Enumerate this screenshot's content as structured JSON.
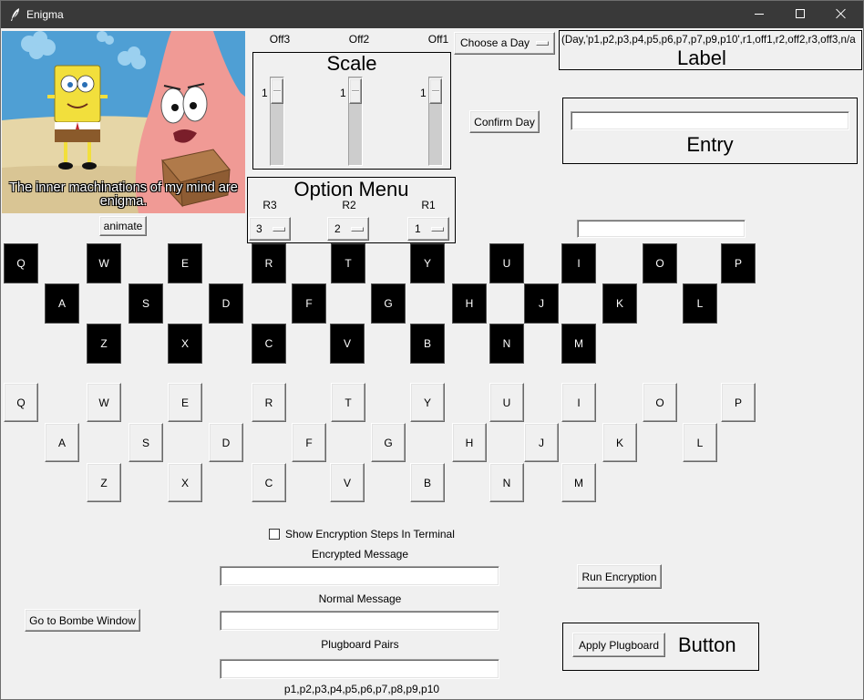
{
  "window": {
    "title": "Enigma",
    "app_icon": "feather-icon",
    "controls": {
      "minimize": "minimize-icon",
      "maximize": "maximize-icon",
      "close": "close-icon"
    }
  },
  "meme": {
    "caption": "The inner machinations of my mind are enigma."
  },
  "offsets": [
    "Off3",
    "Off2",
    "Off1"
  ],
  "scale_frame": {
    "title": "Scale",
    "scales": [
      {
        "value": "1"
      },
      {
        "value": "1"
      },
      {
        "value": "1"
      }
    ]
  },
  "day_menu": {
    "selected": "Choose a Day",
    "indicator_icon": "dropdown-indicator-icon"
  },
  "confirm_day": {
    "label": "Confirm Day"
  },
  "label_frame": {
    "text": "(Day,'p1,p2,p3,p4,p5,p6,p7,p7,p9,p10',r1,off1,r2,off2,r3,off3,n/a",
    "title": "Label"
  },
  "entry_frame": {
    "title": "Entry",
    "value": ""
  },
  "option_frame": {
    "title": "Option Menu",
    "rotors": [
      {
        "label": "R3",
        "selected": "3"
      },
      {
        "label": "R2",
        "selected": "2"
      },
      {
        "label": "R1",
        "selected": "1"
      }
    ]
  },
  "animate": {
    "label": "animate"
  },
  "aux_entry": {
    "value": ""
  },
  "lampboard": {
    "rows": [
      [
        "Q",
        "W",
        "E",
        "R",
        "T",
        "Y",
        "U",
        "I",
        "O",
        "P"
      ],
      [
        "A",
        "S",
        "D",
        "F",
        "G",
        "H",
        "J",
        "K",
        "L"
      ],
      [
        "Z",
        "X",
        "C",
        "V",
        "B",
        "N",
        "M"
      ]
    ]
  },
  "keyboard": {
    "rows": [
      [
        "Q",
        "W",
        "E",
        "R",
        "T",
        "Y",
        "U",
        "I",
        "O",
        "P"
      ],
      [
        "A",
        "S",
        "D",
        "F",
        "G",
        "H",
        "J",
        "K",
        "L"
      ],
      [
        "Z",
        "X",
        "C",
        "V",
        "B",
        "N",
        "M"
      ]
    ]
  },
  "show_steps": {
    "label": "Show Encryption Steps In Terminal",
    "checked": false
  },
  "encrypted_message": {
    "label": "Encrypted Message",
    "value": ""
  },
  "normal_message": {
    "label": "Normal Message",
    "value": ""
  },
  "plugboard_pairs": {
    "label": "Plugboard Pairs",
    "value": "",
    "hint": "p1,p2,p3,p4,p5,p6,p7,p8,p9,p10"
  },
  "run_encryption": {
    "label": "Run Encryption"
  },
  "bombe_window": {
    "label": "Go to Bombe Window"
  },
  "button_frame": {
    "apply_label": "Apply Plugboard",
    "title": "Button"
  },
  "colors": {
    "window_bg": "#f0f0f0",
    "titlebar_bg": "#393939",
    "lamp_bg": "#000000",
    "lamp_text": "#ffffff",
    "frame_border": "#000000"
  }
}
